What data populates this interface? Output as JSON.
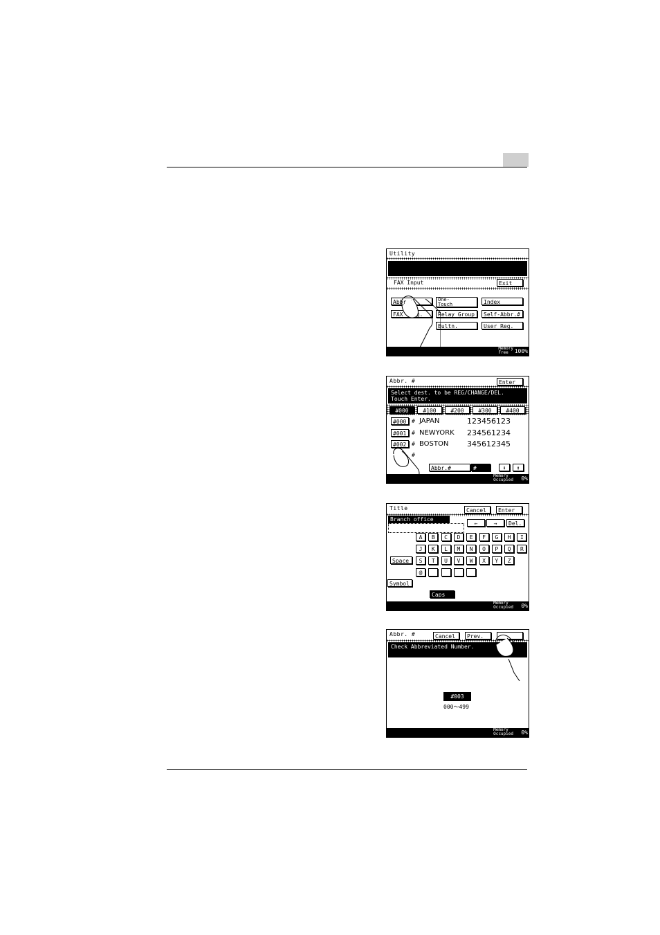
{
  "screen1": {
    "title": "Utility",
    "section": "FAX Input",
    "exit": "Exit",
    "buttons": {
      "abbr": "Abbr.#",
      "fax": "FAX Prog.",
      "one_touch_1": "One-",
      "one_touch_2": "Touch",
      "relay_group": "Relay Group",
      "bultn": "Bultn.",
      "index": "Index",
      "self_abbr": "Self-Abbr.#",
      "user_reg": "User Reg."
    },
    "memory_1": "Memory",
    "memory_2": "Free",
    "memory_value": "100%"
  },
  "screen2": {
    "title": "Abbr. #",
    "enter": "Enter",
    "message_1": "Select dest. to be REG/CHANGE/DEL.",
    "message_2": "Touch Enter.",
    "tabs": [
      "#000",
      "#100",
      "#200",
      "#300",
      "#400"
    ],
    "hash_mark": "#",
    "rows": [
      {
        "num": "#000",
        "name": "JAPAN",
        "phone": "123456123"
      },
      {
        "num": "#001",
        "name": "NEWYORK",
        "phone": "234561234"
      },
      {
        "num": "#002",
        "name": "BOSTON",
        "phone": "345612345"
      }
    ],
    "abbr_field": "Abbr.#",
    "abbr_hash": "#",
    "memory_1": "Memory",
    "memory_2": "Occupied",
    "memory_value": "0%"
  },
  "screen3": {
    "title": "Title",
    "cancel": "Cancel",
    "enter": "Enter",
    "input_value": "Branch office",
    "left_arrow": "←",
    "right_arrow": "→",
    "del": "Del.",
    "keys_row1": [
      "A",
      "B",
      "C",
      "D",
      "E",
      "F",
      "G",
      "H",
      "I"
    ],
    "keys_row2": [
      "J",
      "K",
      "L",
      "M",
      "N",
      "O",
      "P",
      "Q",
      "R"
    ],
    "keys_row3": [
      "S",
      "T",
      "U",
      "V",
      "W",
      "X",
      "Y",
      "Z"
    ],
    "keys_row4": [
      "@",
      "",
      "",
      "",
      ""
    ],
    "space": "Space",
    "symbol": "Symbol",
    "caps": "Caps",
    "memory_1": "Memory",
    "memory_2": "Occupied",
    "memory_value": "0%"
  },
  "screen4": {
    "title": "Abbr. #",
    "cancel": "Cancel",
    "prev": "Prev.",
    "message": "Check Abbreviated Number.",
    "value": "#003",
    "range": "000～499",
    "memory_1": "Memory",
    "memory_2": "Occupied",
    "memory_value": "0%"
  }
}
